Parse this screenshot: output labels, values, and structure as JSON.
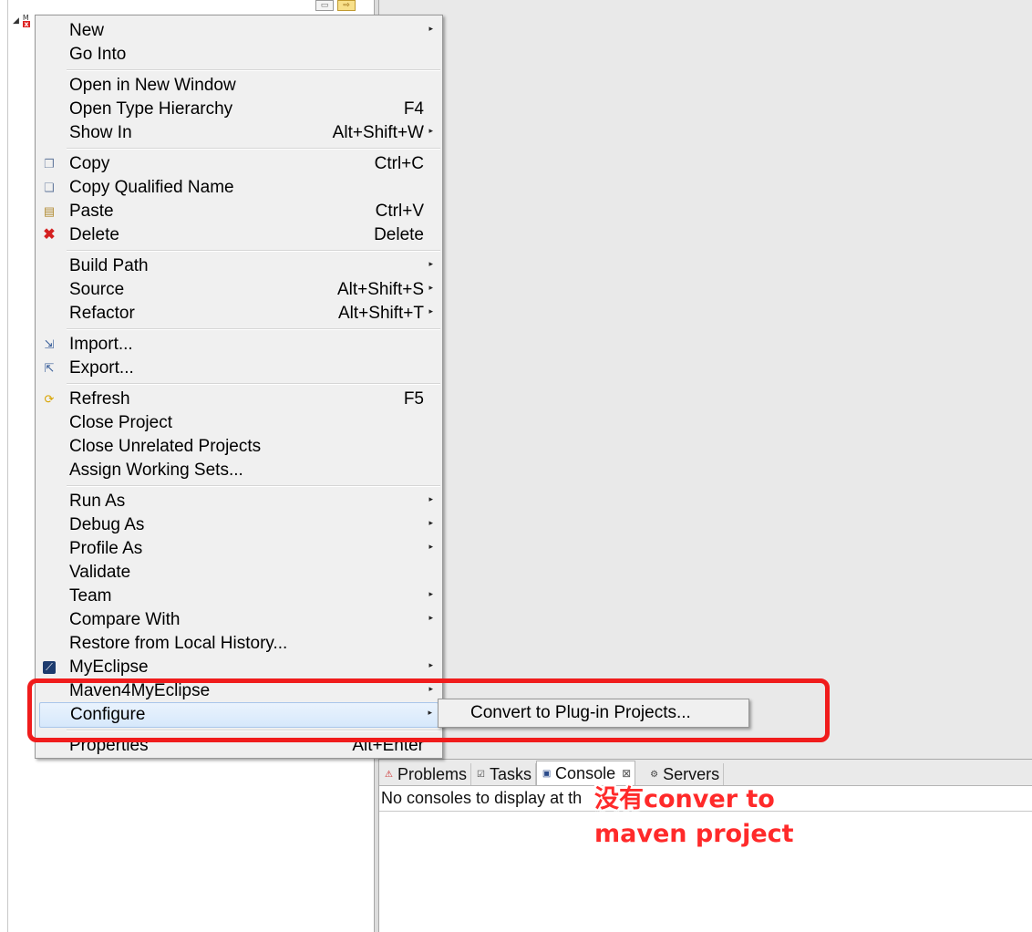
{
  "context_menu": {
    "items": [
      {
        "label": "New",
        "shortcut": "",
        "submenu": true,
        "icon": ""
      },
      {
        "label": "Go Into",
        "shortcut": "",
        "submenu": false,
        "icon": ""
      },
      {
        "label": "Open in New Window",
        "shortcut": "",
        "submenu": false,
        "icon": ""
      },
      {
        "label": "Open Type Hierarchy",
        "shortcut": "F4",
        "submenu": false,
        "icon": ""
      },
      {
        "label": "Show In",
        "shortcut": "Alt+Shift+W",
        "submenu": true,
        "icon": ""
      },
      {
        "label": "Copy",
        "shortcut": "Ctrl+C",
        "submenu": false,
        "icon": "copy-icon"
      },
      {
        "label": "Copy Qualified Name",
        "shortcut": "",
        "submenu": false,
        "icon": "copy-qualified-icon"
      },
      {
        "label": "Paste",
        "shortcut": "Ctrl+V",
        "submenu": false,
        "icon": "paste-icon"
      },
      {
        "label": "Delete",
        "shortcut": "Delete",
        "submenu": false,
        "icon": "delete-icon"
      },
      {
        "label": "Build Path",
        "shortcut": "",
        "submenu": true,
        "icon": ""
      },
      {
        "label": "Source",
        "shortcut": "Alt+Shift+S",
        "submenu": true,
        "icon": ""
      },
      {
        "label": "Refactor",
        "shortcut": "Alt+Shift+T",
        "submenu": true,
        "icon": ""
      },
      {
        "label": "Import...",
        "shortcut": "",
        "submenu": false,
        "icon": "import-icon"
      },
      {
        "label": "Export...",
        "shortcut": "",
        "submenu": false,
        "icon": "export-icon"
      },
      {
        "label": "Refresh",
        "shortcut": "F5",
        "submenu": false,
        "icon": "refresh-icon"
      },
      {
        "label": "Close Project",
        "shortcut": "",
        "submenu": false,
        "icon": ""
      },
      {
        "label": "Close Unrelated Projects",
        "shortcut": "",
        "submenu": false,
        "icon": ""
      },
      {
        "label": "Assign Working Sets...",
        "shortcut": "",
        "submenu": false,
        "icon": ""
      },
      {
        "label": "Run As",
        "shortcut": "",
        "submenu": true,
        "icon": ""
      },
      {
        "label": "Debug As",
        "shortcut": "",
        "submenu": true,
        "icon": ""
      },
      {
        "label": "Profile As",
        "shortcut": "",
        "submenu": true,
        "icon": ""
      },
      {
        "label": "Validate",
        "shortcut": "",
        "submenu": false,
        "icon": ""
      },
      {
        "label": "Team",
        "shortcut": "",
        "submenu": true,
        "icon": ""
      },
      {
        "label": "Compare With",
        "shortcut": "",
        "submenu": true,
        "icon": ""
      },
      {
        "label": "Restore from Local History...",
        "shortcut": "",
        "submenu": false,
        "icon": ""
      },
      {
        "label": "MyEclipse",
        "shortcut": "",
        "submenu": true,
        "icon": "myeclipse-icon"
      },
      {
        "label": "Maven4MyEclipse",
        "shortcut": "",
        "submenu": true,
        "icon": ""
      },
      {
        "label": "Configure",
        "shortcut": "",
        "submenu": true,
        "icon": "",
        "highlighted": true
      },
      {
        "label": "Properties",
        "shortcut": "Alt+Enter",
        "submenu": false,
        "icon": ""
      }
    ]
  },
  "configure_submenu": {
    "items": [
      {
        "label": "Convert to Plug-in Projects..."
      }
    ]
  },
  "bottom_panel": {
    "tabs": [
      {
        "label": "Problems",
        "icon": "problems-icon",
        "active": false
      },
      {
        "label": "Tasks",
        "icon": "tasks-icon",
        "active": false
      },
      {
        "label": "Console",
        "icon": "console-icon",
        "active": true,
        "close": "⊠"
      },
      {
        "label": "Servers",
        "icon": "servers-icon",
        "active": false
      }
    ],
    "console_message": "No consoles to display at th"
  },
  "annotation": {
    "line1": "没有conver to",
    "line2": "maven project",
    "color": "#ff2a2a"
  },
  "highlight_box_color": "#f01c1c"
}
